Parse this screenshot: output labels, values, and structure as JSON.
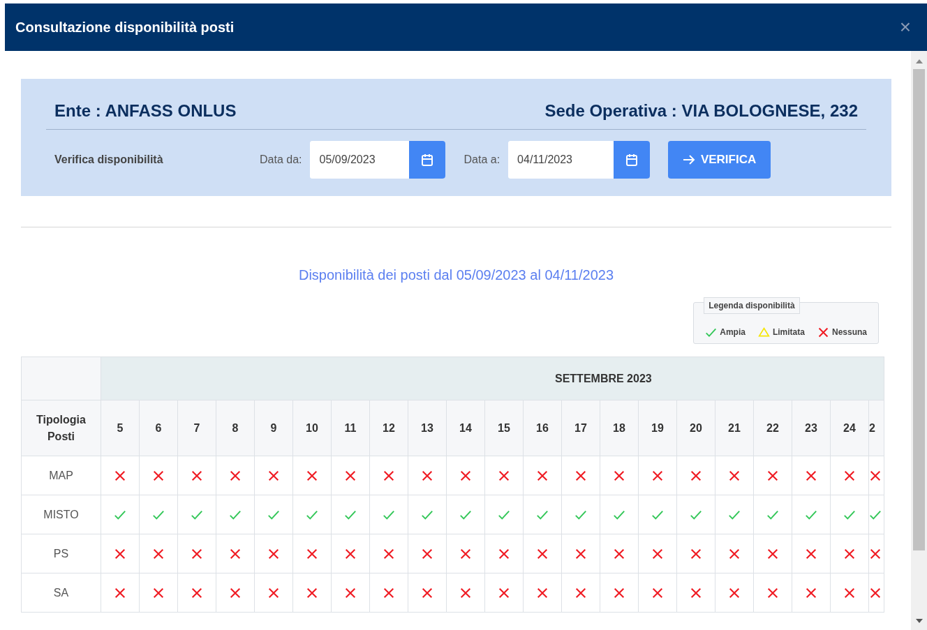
{
  "window": {
    "title": "Consultazione disponibilità posti",
    "close": "×"
  },
  "header": {
    "ente": "Ente : ANFASS ONLUS",
    "sede": "Sede Operativa : VIA BOLOGNESE, 232"
  },
  "filter": {
    "label": "Verifica disponibilità",
    "from_label": "Data da:",
    "from_value": "05/09/2023",
    "to_label": "Data a:",
    "to_value": "04/11/2023",
    "button": "VERIFICA"
  },
  "result_title": "Disponibilità dei posti dal 05/09/2023 al 04/11/2023",
  "legend": {
    "title": "Legenda disponibilità",
    "items": [
      {
        "kind": "ample",
        "label": "Ampia"
      },
      {
        "kind": "limited",
        "label": "Limitata"
      },
      {
        "kind": "none",
        "label": "Nessuna"
      }
    ]
  },
  "table": {
    "month": "SETTEMBRE 2023",
    "corner": "Tipologia Posti",
    "days": [
      "5",
      "6",
      "7",
      "8",
      "9",
      "10",
      "11",
      "12",
      "13",
      "14",
      "15",
      "16",
      "17",
      "18",
      "19",
      "20",
      "21",
      "22",
      "23",
      "24",
      "2"
    ],
    "rows": [
      {
        "name": "MAP",
        "cells": [
          {
            "kind": "none"
          },
          {
            "kind": "none"
          },
          {
            "kind": "none"
          },
          {
            "kind": "none"
          },
          {
            "kind": "none"
          },
          {
            "kind": "none"
          },
          {
            "kind": "none"
          },
          {
            "kind": "none"
          },
          {
            "kind": "none"
          },
          {
            "kind": "none"
          },
          {
            "kind": "none"
          },
          {
            "kind": "none"
          },
          {
            "kind": "none"
          },
          {
            "kind": "none"
          },
          {
            "kind": "none"
          },
          {
            "kind": "none"
          },
          {
            "kind": "none"
          },
          {
            "kind": "none"
          },
          {
            "kind": "none"
          },
          {
            "kind": "none"
          },
          {
            "kind": "none"
          }
        ]
      },
      {
        "name": "MISTO",
        "cells": [
          {
            "kind": "ample"
          },
          {
            "kind": "ample"
          },
          {
            "kind": "ample"
          },
          {
            "kind": "ample"
          },
          {
            "kind": "ample"
          },
          {
            "kind": "ample"
          },
          {
            "kind": "ample"
          },
          {
            "kind": "ample"
          },
          {
            "kind": "ample"
          },
          {
            "kind": "ample"
          },
          {
            "kind": "ample"
          },
          {
            "kind": "ample"
          },
          {
            "kind": "ample"
          },
          {
            "kind": "ample"
          },
          {
            "kind": "ample"
          },
          {
            "kind": "ample"
          },
          {
            "kind": "ample"
          },
          {
            "kind": "ample"
          },
          {
            "kind": "ample"
          },
          {
            "kind": "ample"
          },
          {
            "kind": "ample"
          }
        ]
      },
      {
        "name": "PS",
        "cells": [
          {
            "kind": "none"
          },
          {
            "kind": "none"
          },
          {
            "kind": "none"
          },
          {
            "kind": "none"
          },
          {
            "kind": "none"
          },
          {
            "kind": "none"
          },
          {
            "kind": "none"
          },
          {
            "kind": "none"
          },
          {
            "kind": "none"
          },
          {
            "kind": "none"
          },
          {
            "kind": "none"
          },
          {
            "kind": "none"
          },
          {
            "kind": "none"
          },
          {
            "kind": "none"
          },
          {
            "kind": "none"
          },
          {
            "kind": "none"
          },
          {
            "kind": "none"
          },
          {
            "kind": "none"
          },
          {
            "kind": "none"
          },
          {
            "kind": "none"
          },
          {
            "kind": "none"
          }
        ]
      },
      {
        "name": "SA",
        "cells": [
          {
            "kind": "none"
          },
          {
            "kind": "none"
          },
          {
            "kind": "none"
          },
          {
            "kind": "none"
          },
          {
            "kind": "none"
          },
          {
            "kind": "none"
          },
          {
            "kind": "none"
          },
          {
            "kind": "none"
          },
          {
            "kind": "none"
          },
          {
            "kind": "none"
          },
          {
            "kind": "none"
          },
          {
            "kind": "none"
          },
          {
            "kind": "none"
          },
          {
            "kind": "none"
          },
          {
            "kind": "none"
          },
          {
            "kind": "none"
          },
          {
            "kind": "none"
          },
          {
            "kind": "none"
          },
          {
            "kind": "none"
          },
          {
            "kind": "none"
          },
          {
            "kind": "none"
          }
        ]
      }
    ]
  }
}
